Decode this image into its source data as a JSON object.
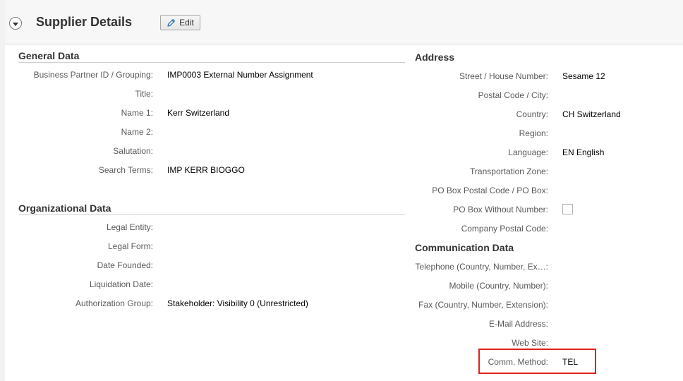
{
  "header": {
    "title": "Supplier Details",
    "edit_label": "Edit"
  },
  "general": {
    "title": "General Data",
    "rows": [
      {
        "label": "Business Partner ID / Grouping:",
        "value": "IMP0003 External Number Assignment"
      },
      {
        "label": "Title:",
        "value": ""
      },
      {
        "label": "Name 1:",
        "value": "Kerr Switzerland"
      },
      {
        "label": "Name 2:",
        "value": ""
      },
      {
        "label": "Salutation:",
        "value": ""
      },
      {
        "label": "Search Terms:",
        "value": "IMP KERR BIOGGO"
      }
    ]
  },
  "org": {
    "title": "Organizational Data",
    "rows": [
      {
        "label": "Legal Entity:",
        "value": ""
      },
      {
        "label": "Legal Form:",
        "value": ""
      },
      {
        "label": "Date Founded:",
        "value": ""
      },
      {
        "label": "Liquidation Date:",
        "value": ""
      },
      {
        "label": "Authorization Group:",
        "value": "Stakeholder: Visibility 0 (Unrestricted)"
      }
    ]
  },
  "address": {
    "title": "Address",
    "rows": [
      {
        "label": "Street / House Number:",
        "value": "Sesame 12"
      },
      {
        "label": "Postal Code / City:",
        "value": ""
      },
      {
        "label": "Country:",
        "value": "CH Switzerland"
      },
      {
        "label": "Region:",
        "value": ""
      },
      {
        "label": "Language:",
        "value": "EN English"
      },
      {
        "label": "Transportation Zone:",
        "value": ""
      },
      {
        "label": "PO Box Postal Code / PO Box:",
        "value": ""
      },
      {
        "label": "PO Box Without Number:",
        "value": ""
      },
      {
        "label": "Company Postal Code:",
        "value": ""
      }
    ]
  },
  "comm": {
    "title": "Communication Data",
    "rows": [
      {
        "label": "Telephone (Country, Number, Ex…:",
        "value": ""
      },
      {
        "label": "Mobile (Country, Number):",
        "value": ""
      },
      {
        "label": "Fax (Country, Number, Extension):",
        "value": ""
      },
      {
        "label": "E-Mail Address:",
        "value": ""
      },
      {
        "label": "Web Site:",
        "value": ""
      },
      {
        "label": "Comm. Method:",
        "value": "TEL"
      }
    ]
  },
  "colors": {
    "highlight": "#e02020",
    "background": "#ffffff"
  }
}
